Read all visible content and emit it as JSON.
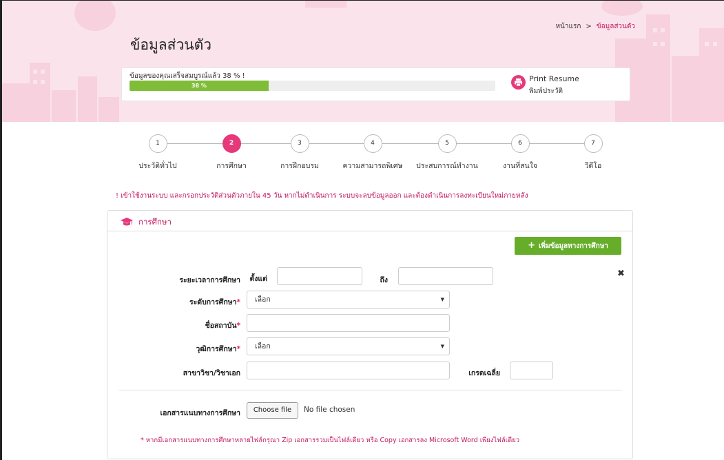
{
  "breadcrumb": {
    "home": "หน้าแรก",
    "separator": ">",
    "current": "ข้อมูลส่วนตัว"
  },
  "page_title": "ข้อมูลส่วนตัว",
  "completion": {
    "label": "ข้อมูลของคุณเสร็จสมบูรณ์แล้ว 38 % !",
    "percent": 38,
    "bar_text": "38 %"
  },
  "print": {
    "label_en": "Print Resume",
    "label_th": "พิมพ์ประวัติ",
    "icon": "printer-icon"
  },
  "steps": [
    {
      "number": "1",
      "label": "ประวัติทั่วไป",
      "active": false
    },
    {
      "number": "2",
      "label": "การศึกษา",
      "active": true
    },
    {
      "number": "3",
      "label": "การฝึกอบรม",
      "active": false
    },
    {
      "number": "4",
      "label": "ความสามารถพิเศษ",
      "active": false
    },
    {
      "number": "5",
      "label": "ประสบการณ์ทำงาน",
      "active": false
    },
    {
      "number": "6",
      "label": "งานที่สนใจ",
      "active": false
    },
    {
      "number": "7",
      "label": "วีดีโอ",
      "active": false
    }
  ],
  "warning": "! เข้าใช้งานระบบ และกรอกประวัติส่วนตัวภายใน 45 วัน หากไม่ดำเนินการ ระบบจะลบข้อมูลออก และต้องดำเนินการลงทะเบียนใหม่ภายหลัง",
  "panel": {
    "title": "การศึกษา",
    "icon": "graduation-cap-icon",
    "add_button": "เพิ่มข้อมูลทางการศึกษา",
    "fields": {
      "period_label": "ระยะเวลาการศึกษา",
      "from_label": "ตั้งแต่",
      "to_label": "ถึง",
      "level_label": "ระดับการศึกษา",
      "level_value": "เลือก",
      "institution_label": "ชื่อสถาบัน",
      "degree_label": "วุฒิการศึกษา",
      "degree_value": "เลือก",
      "major_label": "สาขาวิชา/วิชาเอก",
      "gpa_label": "เกรดเฉลี่ย",
      "required_mark": "*"
    },
    "remove": "✖",
    "attachment": {
      "label": "เอกสารแนบทางการศึกษา",
      "button": "Choose file",
      "status": "No file chosen",
      "note": "* หากมีเอกสารแนบทางการศึกษาหลายไฟล์กรุณา Zip เอกสารรวมเป็นไฟล์เดียว หรือ Copy เอกสารลง Microsoft Word เพียงไฟล์เดียว"
    }
  },
  "colors": {
    "accent": "#e5397a",
    "accent_text": "#c2185b",
    "progress": "#7fbd38",
    "add_button": "#66ae2a",
    "hero_bg": "#fbe3ec"
  }
}
